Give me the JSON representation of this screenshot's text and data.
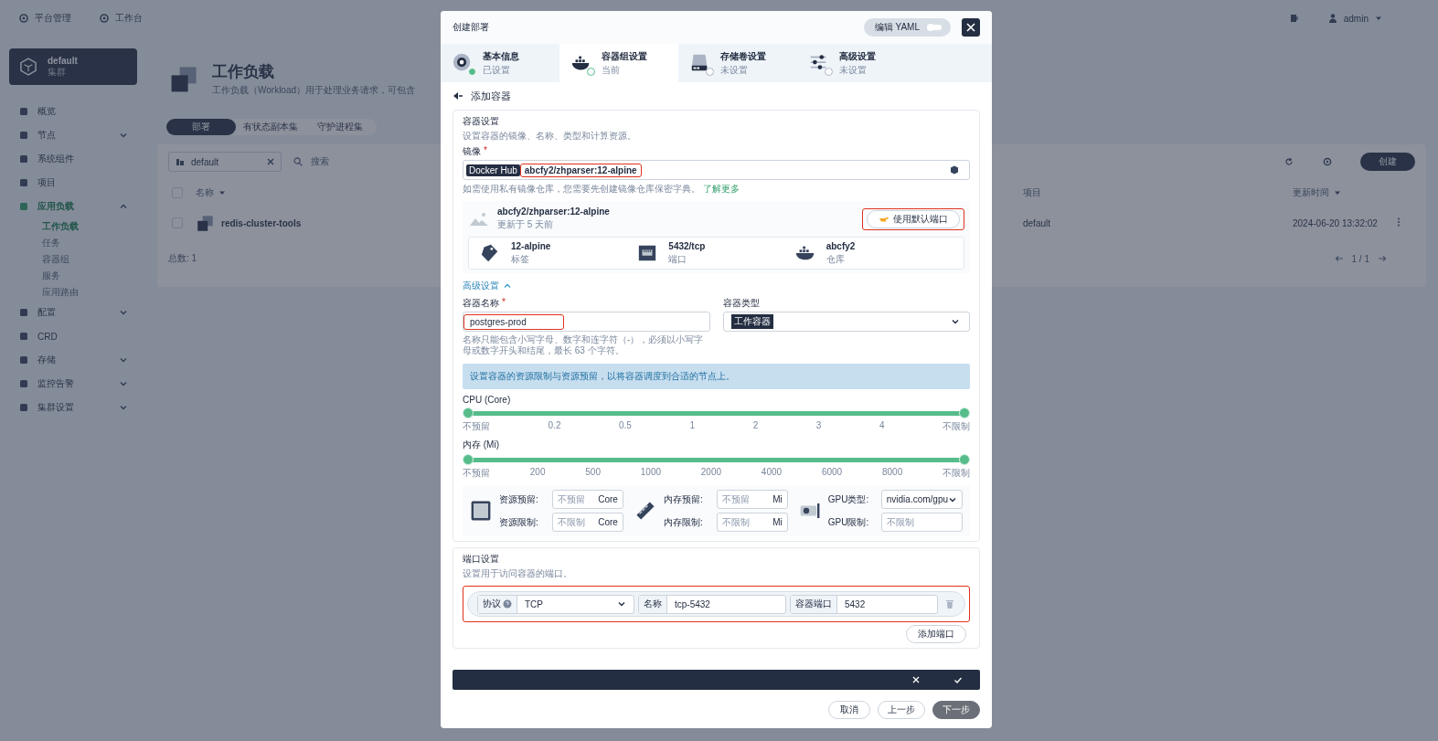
{
  "topbar": {
    "links": [
      {
        "label": "平台管理"
      },
      {
        "label": "工作台"
      }
    ],
    "user": "admin"
  },
  "cluster": {
    "name": "default",
    "subtitle": "集群"
  },
  "sidebar": {
    "items": [
      {
        "label": "概览",
        "selected": false
      },
      {
        "label": "节点",
        "expanded": false,
        "selected": false
      },
      {
        "label": "系统组件",
        "selected": false
      },
      {
        "label": "项目",
        "selected": false
      },
      {
        "label": "应用负载",
        "expanded": true,
        "selected": true,
        "children": [
          {
            "label": "工作负载",
            "selected": true
          },
          {
            "label": "任务",
            "selected": false
          },
          {
            "label": "容器组",
            "selected": false
          },
          {
            "label": "服务",
            "selected": false
          },
          {
            "label": "应用路由",
            "selected": false
          }
        ]
      },
      {
        "label": "配置",
        "expanded": false,
        "selected": false
      },
      {
        "label": "CRD",
        "selected": false
      },
      {
        "label": "存储",
        "expanded": false,
        "selected": false
      },
      {
        "label": "监控告警",
        "expanded": false,
        "selected": false
      },
      {
        "label": "集群设置",
        "expanded": false,
        "selected": false
      }
    ]
  },
  "page": {
    "title": "工作负载",
    "description": "工作负载（Workload）用于处理业务请求，可包含",
    "tabs": [
      {
        "label": "部署",
        "selected": true
      },
      {
        "label": "有状态副本集",
        "selected": false
      },
      {
        "label": "守护进程集",
        "selected": false
      }
    ],
    "filter": {
      "value": "default"
    },
    "search": {
      "placeholder": "搜索"
    },
    "create_button": "创建",
    "table": {
      "all_checked": false,
      "columns": [
        {
          "label": "名称",
          "sortable": true
        },
        {
          "label": "项目",
          "sortable": false
        },
        {
          "label": "更新时间",
          "sortable": true
        }
      ],
      "rows": [
        {
          "checked": false,
          "name": "redis-cluster-tools",
          "project": "default",
          "updated": "2024-06-20 13:32:02"
        }
      ]
    },
    "total": "总数: 1",
    "pagination": "1 / 1"
  },
  "modal": {
    "title": "创建部署",
    "yaml_toggle": {
      "label": "编辑 YAML",
      "on": false
    },
    "steps": [
      {
        "title": "基本信息",
        "status": "已设置",
        "done": true,
        "selected": false
      },
      {
        "title": "容器组设置",
        "status": "当前",
        "done": false,
        "selected": true
      },
      {
        "title": "存储卷设置",
        "status": "未设置",
        "done": false,
        "selected": false
      },
      {
        "title": "高级设置",
        "status": "未设置",
        "done": false,
        "selected": false
      }
    ],
    "back_title": "添加容器",
    "container": {
      "title": "容器设置",
      "description": "设置容器的镜像、名称、类型和计算资源。",
      "image_label": "镜像",
      "image_required_mark": "*",
      "registry": "Docker Hub",
      "image": "abcfy2/zhparser:12-alpine",
      "image_highlighted": true,
      "hint": "如需使用私有镜像仓库，您需要先创建镜像仓库保密字典。",
      "hint_link": "了解更多",
      "image_card": {
        "name": "abcfy2/zhparser:12-alpine",
        "updated": "更新于 5 天前",
        "button": "使用默认端口",
        "button_highlighted": true,
        "facts": [
          {
            "kind": "tag",
            "value": "12-alpine",
            "label": "标签"
          },
          {
            "kind": "port",
            "value": "5432/tcp",
            "label": "端口"
          },
          {
            "kind": "repo",
            "value": "abcfy2",
            "label": "仓库"
          }
        ]
      },
      "advanced_toggle": {
        "label": "高级设置",
        "expanded": true
      },
      "name_field": {
        "label": "容器名称",
        "required_mark": "*",
        "value": "postgres-prod",
        "highlighted": true
      },
      "type_field": {
        "label": "容器类型",
        "value": "工作容器"
      },
      "name_hint": "名称只能包含小写字母、数字和连字符（-），必须以小写字母或数字开头和结尾，最长 63 个字符。",
      "banner": "设置容器的资源限制与资源预留，以将容器调度到合适的节点上。",
      "sliders": [
        {
          "label": "CPU (Core)",
          "handles": [
            {
              "level": 0
            },
            {
              "level": 1
            }
          ],
          "ticks": [
            "不预留",
            "0.2",
            "0.5",
            "1",
            "2",
            "3",
            "4",
            "不限制"
          ]
        },
        {
          "label": "内存 (Mi)",
          "handles": [
            {
              "level": 0
            },
            {
              "level": 1
            }
          ],
          "ticks": [
            "不预留",
            "200",
            "500",
            "1000",
            "2000",
            "4000",
            "6000",
            "8000",
            "不限制"
          ]
        }
      ],
      "resources": [
        {
          "kind": "cpu",
          "fields": [
            {
              "kind": "input",
              "label": "资源预留:",
              "placeholder": "不预留",
              "unit": "Core"
            },
            {
              "kind": "input",
              "label": "资源限制:",
              "placeholder": "不限制",
              "unit": "Core"
            }
          ]
        },
        {
          "kind": "memory",
          "fields": [
            {
              "kind": "input",
              "label": "内存预留:",
              "placeholder": "不预留",
              "unit": "Mi"
            },
            {
              "kind": "input",
              "label": "内存限制:",
              "placeholder": "不限制",
              "unit": "Mi"
            }
          ]
        },
        {
          "kind": "gpu",
          "fields": [
            {
              "kind": "select",
              "label": "GPU类型:",
              "value": "nvidia.com/gpu"
            },
            {
              "kind": "input",
              "label": "GPU限制:",
              "placeholder": "不限制"
            }
          ]
        }
      ]
    },
    "ports": {
      "title": "端口设置",
      "description": "设置用于访问容器的端口。",
      "rows": [
        {
          "highlighted": true,
          "protocol_label": "协议",
          "protocol": "TCP",
          "name_label": "名称",
          "name": "tcp-5432",
          "port_label": "容器端口",
          "port": "5432"
        }
      ],
      "add_button": "添加端口"
    },
    "footer": [
      {
        "label": "取消",
        "kind": "default"
      },
      {
        "label": "上一步",
        "kind": "default"
      },
      {
        "label": "下一步",
        "kind": "primary"
      }
    ]
  }
}
